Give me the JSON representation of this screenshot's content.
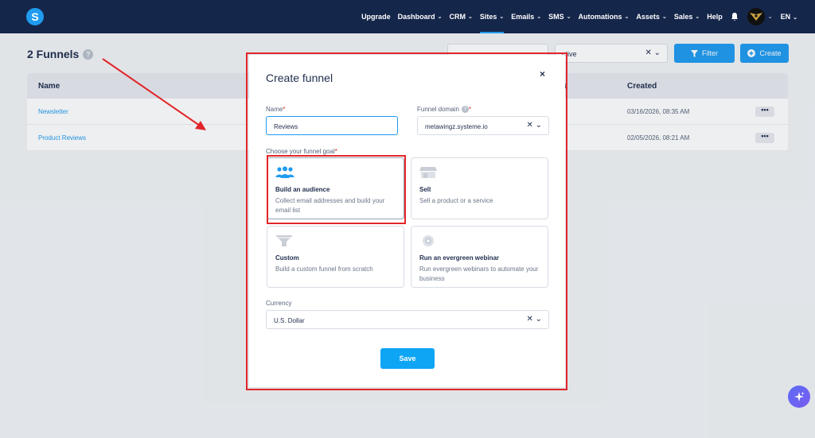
{
  "nav": {
    "logo_letter": "S",
    "items": [
      {
        "label": "Upgrade",
        "has_menu": false
      },
      {
        "label": "Dashboard",
        "has_menu": true
      },
      {
        "label": "CRM",
        "has_menu": true
      },
      {
        "label": "Sites",
        "has_menu": true,
        "active": true
      },
      {
        "label": "Emails",
        "has_menu": true
      },
      {
        "label": "SMS",
        "has_menu": true
      },
      {
        "label": "Automations",
        "has_menu": true
      },
      {
        "label": "Assets",
        "has_menu": true
      },
      {
        "label": "Sales",
        "has_menu": true
      },
      {
        "label": "Help",
        "has_menu": false
      }
    ],
    "language": "EN"
  },
  "page": {
    "title": "2 Funnels",
    "help": "?",
    "status_filter_value": "ctive",
    "filter_button": "Filter",
    "create_button": "Create"
  },
  "table": {
    "columns": {
      "name": "Name",
      "partial": "s",
      "created": "Created"
    },
    "rows": [
      {
        "name": "Newsletter",
        "created": "03/16/2026, 08:35 AM"
      },
      {
        "name": "Product Reviews",
        "created": "02/05/2026, 08:21 AM"
      }
    ],
    "more": "•••"
  },
  "modal": {
    "title": "Create funnel",
    "close": "×",
    "name_label": "Name",
    "name_value": "Reviews",
    "domain_label": "Funnel domain",
    "domain_value": "metawingz.systeme.io",
    "goal_label": "Choose your funnel goal",
    "required_mark": "*",
    "goals": [
      {
        "title": "Build an audience",
        "desc": "Collect email addresses and build your email list",
        "icon": "audience-icon",
        "selected": true
      },
      {
        "title": "Sell",
        "desc": "Sell a product or a service",
        "icon": "shop-icon"
      },
      {
        "title": "Custom",
        "desc": "Build a custom funnel from scratch",
        "icon": "funnel-icon"
      },
      {
        "title": "Run an evergreen webinar",
        "desc": "Run evergreen webinars to automate your business",
        "icon": "webinar-icon"
      }
    ],
    "currency_label": "Currency",
    "currency_value": "U.S. Dollar",
    "save_button": "Save"
  },
  "colors": {
    "nav_bg": "#15264b",
    "accent": "#1f9bf0",
    "annotation_red": "#e2262a"
  }
}
